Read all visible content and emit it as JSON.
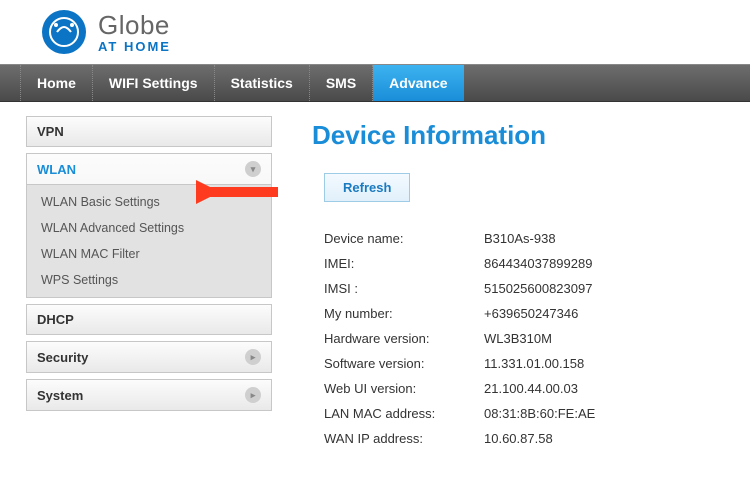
{
  "brand": {
    "name": "Globe",
    "sub": "AT HOME"
  },
  "nav": {
    "items": [
      "Home",
      "WIFI Settings",
      "Statistics",
      "SMS",
      "Advance"
    ],
    "active_index": 4
  },
  "sidebar": {
    "panels": [
      {
        "label": "VPN",
        "expanded": false,
        "selected": false,
        "items": [],
        "chevron": false
      },
      {
        "label": "WLAN",
        "expanded": true,
        "selected": true,
        "items": [
          "WLAN Basic Settings",
          "WLAN Advanced Settings",
          "WLAN MAC Filter",
          "WPS Settings"
        ],
        "chevron": true
      },
      {
        "label": "DHCP",
        "expanded": false,
        "selected": false,
        "items": [],
        "chevron": false
      },
      {
        "label": "Security",
        "expanded": false,
        "selected": false,
        "items": [],
        "chevron": true
      },
      {
        "label": "System",
        "expanded": false,
        "selected": false,
        "items": [],
        "chevron": true
      }
    ]
  },
  "page": {
    "title": "Device Information",
    "refresh_label": "Refresh",
    "rows": [
      {
        "label": "Device name:",
        "value": "B310As-938"
      },
      {
        "label": "IMEI:",
        "value": "864434037899289"
      },
      {
        "label": "IMSI :",
        "value": "515025600823097"
      },
      {
        "label": "My number:",
        "value": "+639650247346"
      },
      {
        "label": "Hardware version:",
        "value": "WL3B310M"
      },
      {
        "label": "Software version:",
        "value": "11.331.01.00.158"
      },
      {
        "label": "Web UI version:",
        "value": "21.100.44.00.03"
      },
      {
        "label": "LAN MAC address:",
        "value": "08:31:8B:60:FE:AE"
      },
      {
        "label": "WAN IP address:",
        "value": "10.60.87.58"
      }
    ]
  },
  "annotation": {
    "type": "arrow",
    "color": "#ff3b1f",
    "points_to": "WLAN Basic Settings"
  }
}
